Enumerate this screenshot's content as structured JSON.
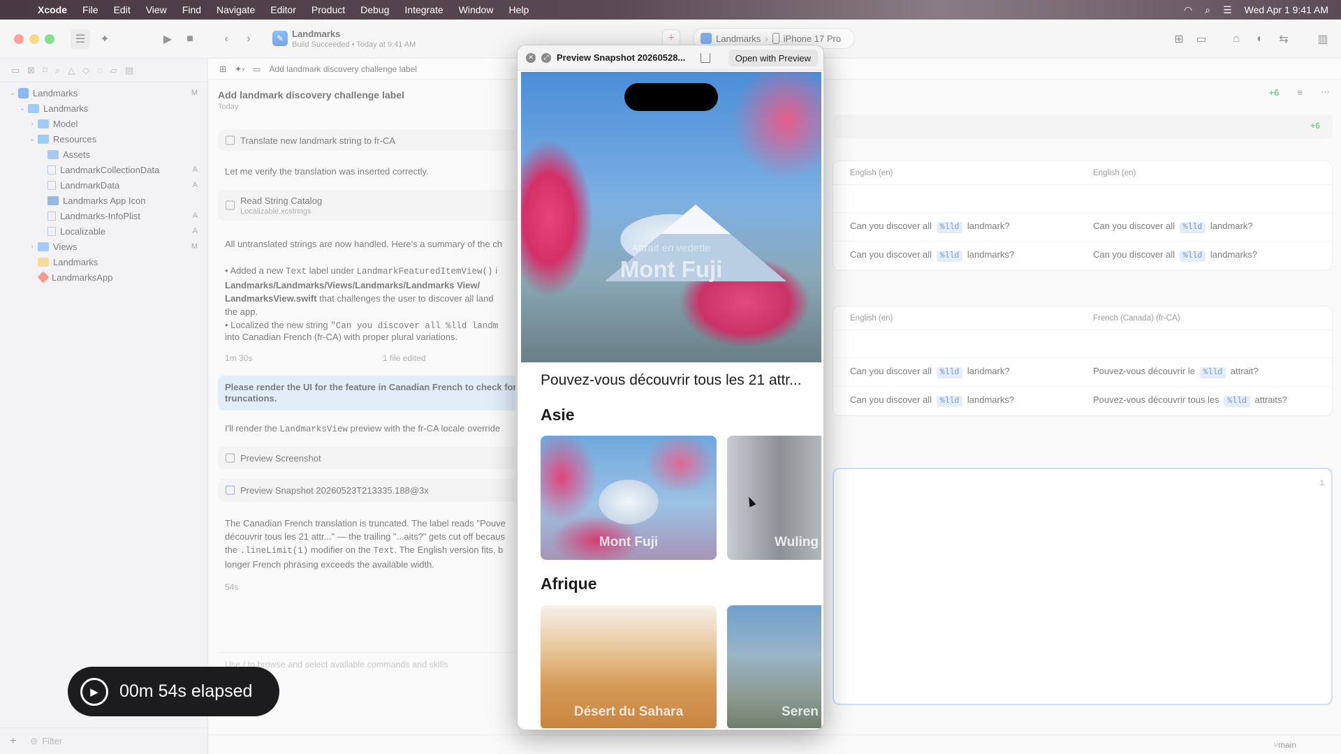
{
  "menubar": {
    "app": "Xcode",
    "items": [
      "File",
      "Edit",
      "View",
      "Find",
      "Navigate",
      "Editor",
      "Product",
      "Debug",
      "Integrate",
      "Window",
      "Help"
    ],
    "datetime": "Wed Apr 1  9:41 AM"
  },
  "toolbar": {
    "project_name": "Landmarks",
    "build_status": "Build Succeeded • Today at 9:41 AM",
    "scheme": "Landmarks",
    "device": "iPhone 17 Pro"
  },
  "jump_bar": {
    "label": "Add landmark discovery challenge label"
  },
  "sidebar": {
    "rows": [
      {
        "label": "Landmarks",
        "badge": "M"
      },
      {
        "label": "Landmarks",
        "badge": ""
      },
      {
        "label": "Model",
        "badge": ""
      },
      {
        "label": "Resources",
        "badge": ""
      },
      {
        "label": "Assets",
        "badge": ""
      },
      {
        "label": "LandmarkCollectionData",
        "badge": "A"
      },
      {
        "label": "LandmarkData",
        "badge": "A"
      },
      {
        "label": "Landmarks App Icon",
        "badge": ""
      },
      {
        "label": "Landmarks-InfoPlist",
        "badge": "A"
      },
      {
        "label": "Localizable",
        "badge": "A"
      },
      {
        "label": "Views",
        "badge": "M"
      },
      {
        "label": "Landmarks",
        "badge": ""
      },
      {
        "label": "LandmarksApp",
        "badge": ""
      }
    ],
    "filter_placeholder": "Filter"
  },
  "conversation": {
    "title": "Add landmark discovery challenge label",
    "date": "Today",
    "tool_translate": "Translate new landmark string to fr-CA",
    "verify_text": "Let me verify the translation was inserted correctly.",
    "tool_read": "Read String Catalog",
    "tool_read_file": "Localizable.xcstrings",
    "summary_intro": "All untranslated strings are now handled. Here's a summary of the ch",
    "bullet1_a": "• Added a new ",
    "bullet1_code1": "Text",
    "bullet1_b": " label under ",
    "bullet1_code2": "LandmarkFeaturedItemView()",
    "bullet1_c": " i",
    "bullet1_path1": "Landmarks/Landmarks/Views/Landmarks/Landmarks View/",
    "bullet1_path2": "LandmarksView.swift",
    "bullet1_d": " that challenges the user to discover all land",
    "bullet1_e": "the app.",
    "bullet2_a": "• Localized the new string ",
    "bullet2_code": "\"Can you discover all %lld landm",
    "bullet2_b": "into Canadian French (fr-CA) with proper plural variations.",
    "duration1": "1m 30s",
    "files_edited": "1 file edited",
    "user_message": "Please render the UI for the feature in Canadian French to check for truncations.",
    "render_a": "I'll render the ",
    "render_code": "LandmarksView",
    "render_b": " preview with the fr-CA locale override",
    "tool_screenshot": "Preview Screenshot",
    "tool_snapshot": "Preview Snapshot 20260523T213335.188@3x",
    "result_line1": "The Canadian French translation is truncated. The label reads \"Pouve",
    "result_line2": "découvrir tous les 21 attr...\" — the trailing \"...aits?\" gets cut off becaus",
    "result_line3_a": "the ",
    "result_line3_code1": ".lineLimit(1)",
    "result_line3_b": " modifier on the ",
    "result_line3_code2": "Text",
    "result_line3_c": ". The English version fits, b",
    "result_line4": "longer French phrasing exceeds the available width.",
    "duration2": "54s",
    "input_placeholder": "Use / to browse and select available commands and skills"
  },
  "catalog": {
    "count_badge": "+6",
    "sections": [
      {
        "headers": [
          "English (en)",
          "English (en)"
        ],
        "rows": [
          {
            "left_pre": "Can you discover all ",
            "left_token": "%lld",
            "left_post": " landmark?",
            "right_pre": "Can you discover all ",
            "right_token": "%lld",
            "right_post": " landmark?"
          },
          {
            "left_pre": "Can you discover all ",
            "left_token": "%lld",
            "left_post": " landmarks?",
            "right_pre": "Can you discover all ",
            "right_token": "%lld",
            "right_post": " landmarks?"
          }
        ]
      },
      {
        "headers": [
          "English (en)",
          "French (Canada) (fr-CA)"
        ],
        "rows": [
          {
            "left_pre": "Can you discover all ",
            "left_token": "%lld",
            "left_post": " landmark?",
            "right_pre": "Pouvez-vous découvrir le ",
            "right_token": "%lld",
            "right_post": " attrait?"
          },
          {
            "left_pre": "Can you discover all ",
            "left_token": "%lld",
            "left_post": " landmarks?",
            "right_pre": "Pouvez-vous découvrir tous les ",
            "right_token": "%lld",
            "right_post": " attraits?"
          }
        ]
      }
    ],
    "selected_count": "1"
  },
  "preview": {
    "title": "Preview Snapshot 20260528...",
    "open_button": "Open with Preview",
    "hero_kicker": "Attrait en vedette",
    "hero_name": "Mont Fuji",
    "challenge": "Pouvez-vous découvrir tous les 21 attr...",
    "region1": "Asie",
    "region1_cards": [
      "Mont Fuji",
      "Wuling"
    ],
    "region2": "Afrique",
    "region2_cards": [
      "Désert du Sahara",
      "Seren"
    ]
  },
  "timer": {
    "elapsed": "00m 54s elapsed"
  },
  "statusbar": {
    "branch": "main"
  }
}
